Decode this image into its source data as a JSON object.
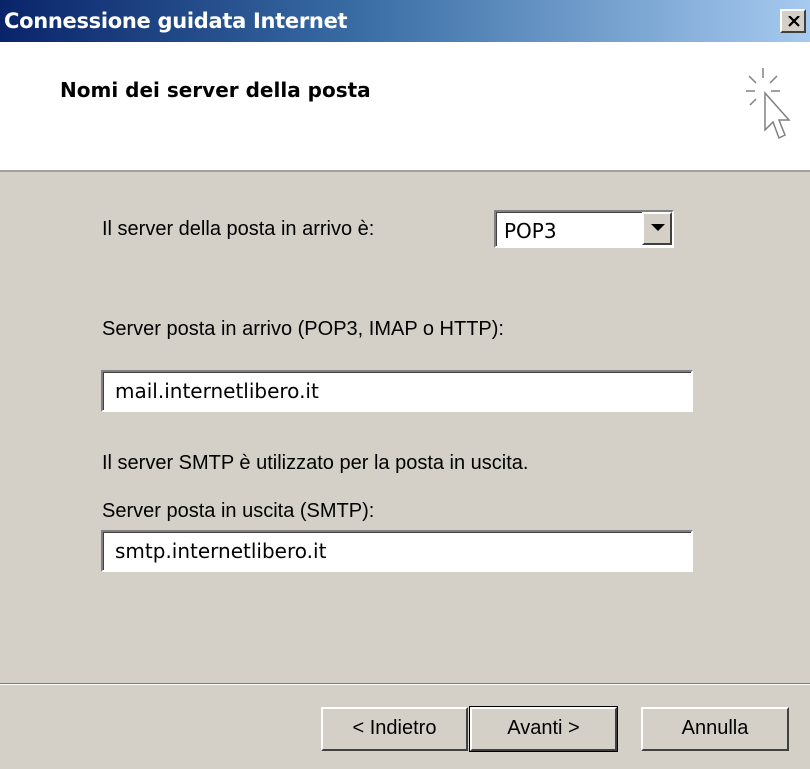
{
  "window": {
    "title": "Connessione guidata Internet"
  },
  "header": {
    "title": "Nomi dei server della posta"
  },
  "incoming_type": {
    "label": "Il server della posta in arrivo è:",
    "selected": "POP3"
  },
  "incoming_server": {
    "label": "Server posta in arrivo (POP3, IMAP o HTTP):",
    "value": "mail.internetlibero.it"
  },
  "smtp_note": "Il server SMTP è utilizzato per la posta in uscita.",
  "outgoing_server": {
    "label": "Server posta in uscita (SMTP):",
    "value": "smtp.internetlibero.it"
  },
  "buttons": {
    "back": "< Indietro",
    "next": "Avanti >",
    "cancel": "Annulla"
  },
  "icons": {
    "close": "close-icon",
    "wizard": "wizard-cursor-icon",
    "dropdown": "chevron-down-icon"
  }
}
